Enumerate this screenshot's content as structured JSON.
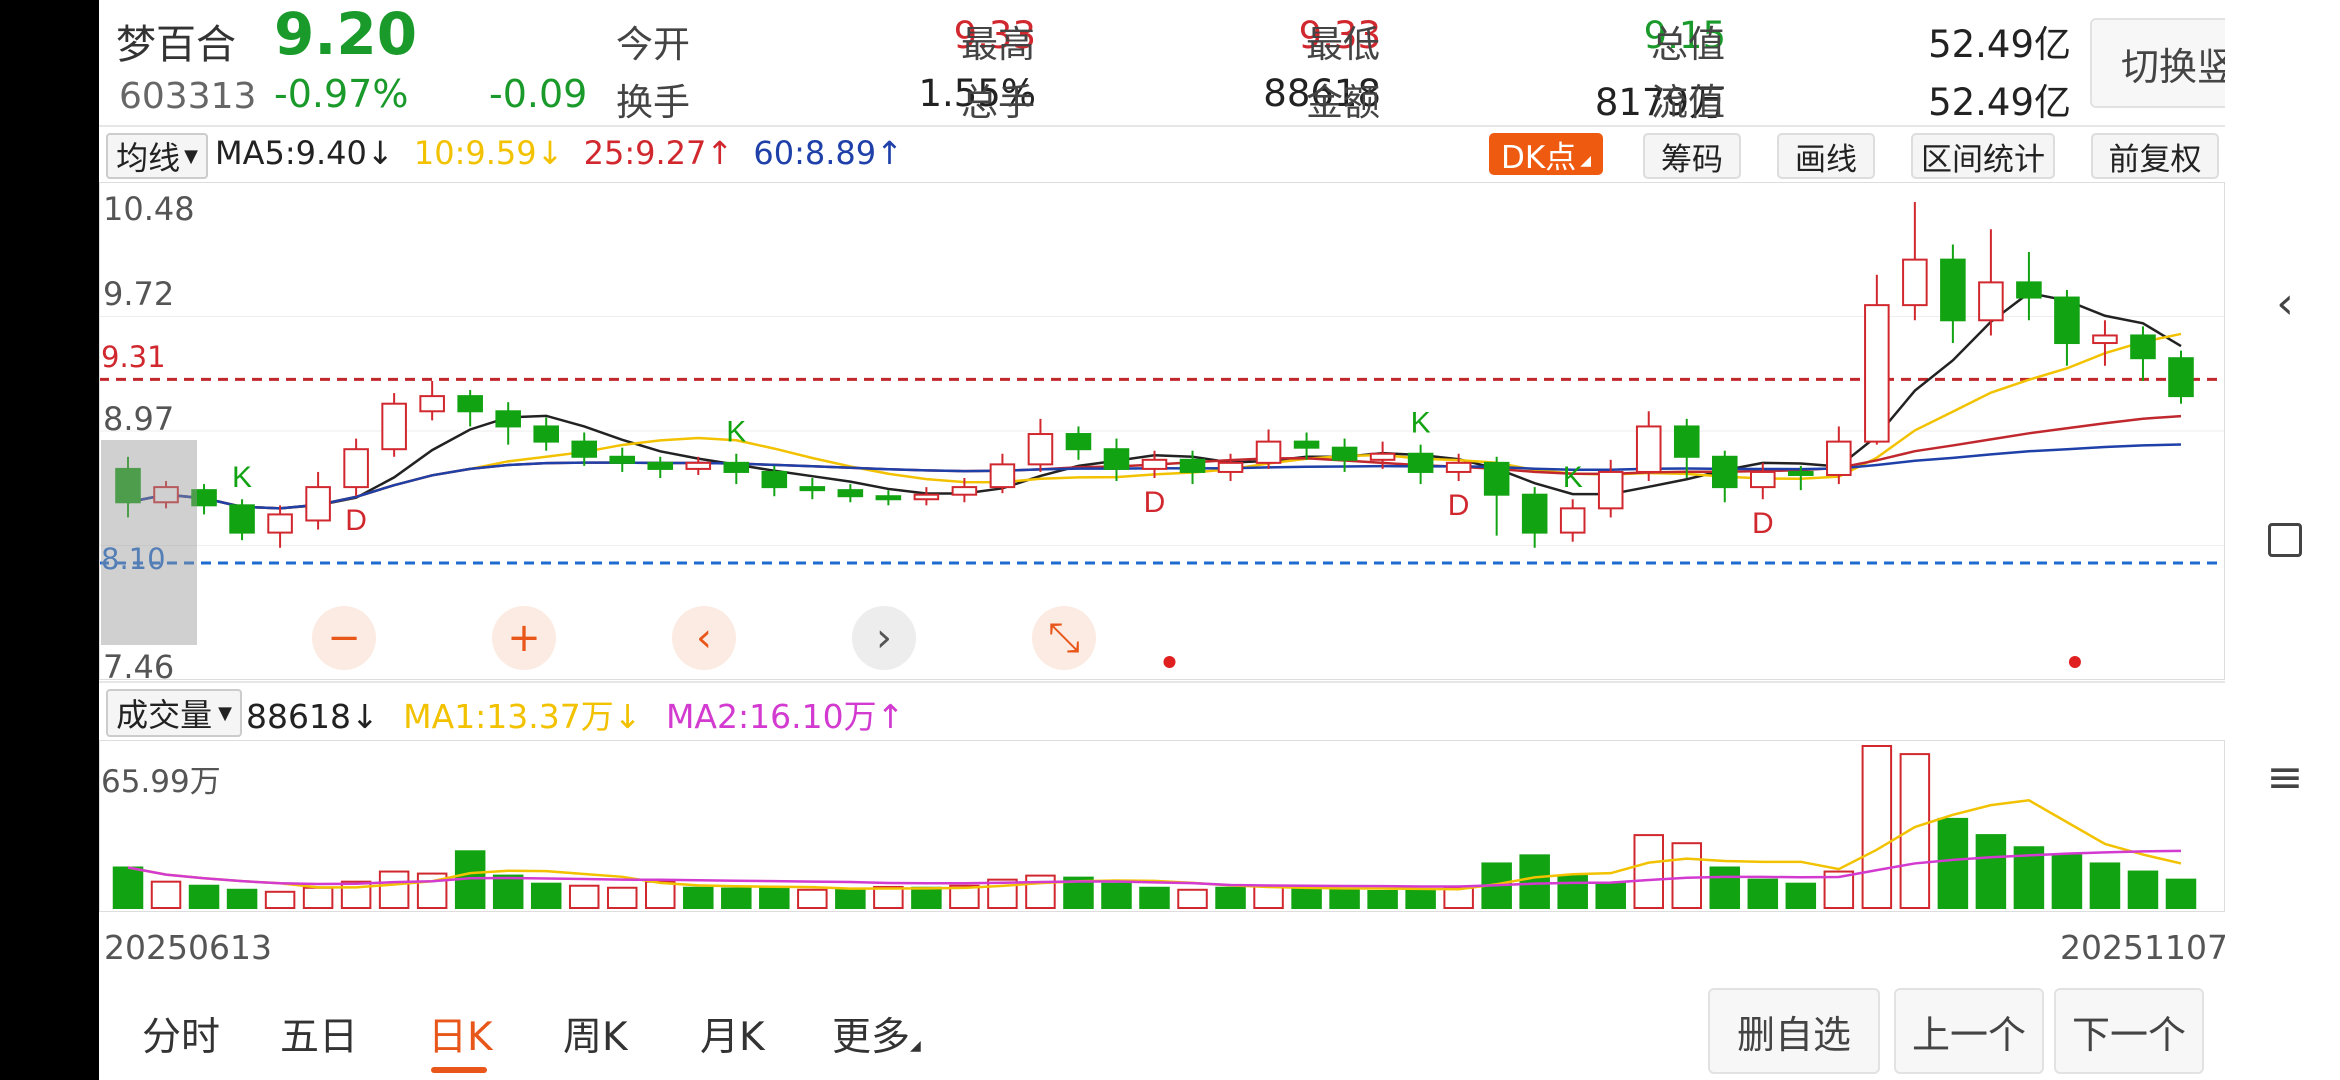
{
  "header": {
    "name": "梦百合",
    "price": "9.20",
    "code": "603313",
    "change_pct": "-0.97%",
    "change": "-0.09",
    "stats": [
      {
        "label": "今开",
        "value": "9.33",
        "color": "red"
      },
      {
        "label": "最高",
        "value": "9.33",
        "color": "red"
      },
      {
        "label": "最低",
        "value": "9.15",
        "color": "green"
      },
      {
        "label": "总值",
        "value": "52.49亿",
        "color": "dark"
      },
      {
        "label": "换手",
        "value": "1.55%",
        "color": "dark"
      },
      {
        "label": "总手",
        "value": "88618",
        "color": "dark"
      },
      {
        "label": "金额",
        "value": "8179万",
        "color": "dark"
      },
      {
        "label": "流值",
        "value": "52.49亿",
        "color": "dark"
      }
    ],
    "switch_label": "切换竖屏"
  },
  "toolbar": {
    "ma_select": "均线",
    "ma_values": [
      {
        "text": "MA5:9.40",
        "arrow": "↓",
        "color": "#222222"
      },
      {
        "text": "10:9.59",
        "arrow": "↓",
        "color": "#f2c200"
      },
      {
        "text": "25:9.27",
        "arrow": "↑",
        "color": "#d0282e"
      },
      {
        "text": "60:8.89",
        "arrow": "↑",
        "color": "#1e40a8"
      }
    ],
    "dk_label": "DK点",
    "chip_label": "筹码",
    "draw_label": "画线",
    "range_label": "区间统计",
    "adjust_label": "前复权"
  },
  "price_axis": {
    "ticks": [
      "10.48",
      "9.72",
      "9.31",
      "8.97",
      "8.10",
      "7.46"
    ]
  },
  "volume_bar": {
    "select": "成交量",
    "vol_value": "88618",
    "vol_arrow": "↓",
    "ma1": "MA1:13.37万",
    "ma1_arrow": "↓",
    "ma2": "MA2:16.10万",
    "ma2_arrow": "↑",
    "max_label": "65.99万"
  },
  "dates": {
    "start": "20250613",
    "end": "20251107"
  },
  "tabs": [
    {
      "label": "分时",
      "active": false
    },
    {
      "label": "五日",
      "active": false
    },
    {
      "label": "日K",
      "active": true
    },
    {
      "label": "周K",
      "active": false
    },
    {
      "label": "月K",
      "active": false
    },
    {
      "label": "更多",
      "active": false
    }
  ],
  "bottom_buttons": {
    "delete": "删自选",
    "prev": "上一个",
    "next": "下一个"
  },
  "controls": {
    "zoom_out": "−",
    "zoom_in": "+",
    "left": "‹",
    "right": "›",
    "shrink": "⤡"
  },
  "colors": {
    "up": "#d0282e",
    "down": "#12a312",
    "ma5": "#222222",
    "ma10": "#f2c200",
    "ma25": "#c0282e",
    "ma60": "#1e40a8",
    "accent": "#e8561a"
  },
  "chart_data": {
    "type": "candlestick",
    "price_range": [
      7.46,
      10.48
    ],
    "ref_lines": [
      9.31,
      8.1
    ],
    "signals": [
      {
        "label": "K",
        "type": "K",
        "index": 3
      },
      {
        "label": "D",
        "type": "D",
        "index": 6
      },
      {
        "label": "K",
        "type": "K",
        "index": 16
      },
      {
        "label": "D",
        "type": "D",
        "index": 27
      },
      {
        "label": "K",
        "type": "K",
        "index": 34
      },
      {
        "label": "D",
        "type": "D",
        "index": 35
      },
      {
        "label": "K",
        "type": "K",
        "index": 38
      },
      {
        "label": "D",
        "type": "D",
        "index": 43
      }
    ],
    "candles": [
      [
        8.72,
        8.5,
        8.8,
        8.4
      ],
      [
        8.5,
        8.6,
        8.64,
        8.46
      ],
      [
        8.58,
        8.48,
        8.62,
        8.42
      ],
      [
        8.48,
        8.3,
        8.52,
        8.25
      ],
      [
        8.3,
        8.42,
        8.48,
        8.2
      ],
      [
        8.38,
        8.6,
        8.7,
        8.32
      ],
      [
        8.6,
        8.85,
        8.92,
        8.54
      ],
      [
        8.85,
        9.15,
        9.22,
        8.8
      ],
      [
        9.1,
        9.2,
        9.3,
        9.04
      ],
      [
        9.2,
        9.1,
        9.24,
        9.0
      ],
      [
        9.1,
        9.0,
        9.16,
        8.88
      ],
      [
        9.0,
        8.9,
        9.06,
        8.84
      ],
      [
        8.9,
        8.8,
        8.96,
        8.74
      ],
      [
        8.8,
        8.76,
        8.86,
        8.7
      ],
      [
        8.76,
        8.72,
        8.8,
        8.66
      ],
      [
        8.72,
        8.76,
        8.8,
        8.68
      ],
      [
        8.76,
        8.7,
        8.82,
        8.62
      ],
      [
        8.7,
        8.6,
        8.74,
        8.54
      ],
      [
        8.6,
        8.58,
        8.66,
        8.52
      ],
      [
        8.58,
        8.54,
        8.62,
        8.5
      ],
      [
        8.54,
        8.52,
        8.58,
        8.48
      ],
      [
        8.52,
        8.55,
        8.6,
        8.48
      ],
      [
        8.55,
        8.6,
        8.66,
        8.5
      ],
      [
        8.6,
        8.75,
        8.82,
        8.56
      ],
      [
        8.75,
        8.95,
        9.05,
        8.7
      ],
      [
        8.95,
        8.85,
        9.0,
        8.78
      ],
      [
        8.85,
        8.72,
        8.92,
        8.64
      ],
      [
        8.72,
        8.78,
        8.84,
        8.66
      ],
      [
        8.78,
        8.7,
        8.84,
        8.62
      ],
      [
        8.7,
        8.76,
        8.82,
        8.64
      ],
      [
        8.76,
        8.9,
        8.98,
        8.72
      ],
      [
        8.9,
        8.86,
        8.96,
        8.78
      ],
      [
        8.86,
        8.78,
        8.92,
        8.7
      ],
      [
        8.78,
        8.82,
        8.9,
        8.72
      ],
      [
        8.82,
        8.7,
        8.88,
        8.62
      ],
      [
        8.7,
        8.76,
        8.82,
        8.64
      ],
      [
        8.76,
        8.55,
        8.8,
        8.28
      ],
      [
        8.55,
        8.3,
        8.6,
        8.2
      ],
      [
        8.3,
        8.46,
        8.52,
        8.24
      ],
      [
        8.46,
        8.7,
        8.78,
        8.4
      ],
      [
        8.7,
        9.0,
        9.1,
        8.64
      ],
      [
        9.0,
        8.8,
        9.05,
        8.66
      ],
      [
        8.8,
        8.6,
        8.84,
        8.5
      ],
      [
        8.6,
        8.7,
        8.76,
        8.52
      ],
      [
        8.7,
        8.68,
        8.74,
        8.58
      ],
      [
        8.68,
        8.9,
        9.0,
        8.62
      ],
      [
        8.9,
        9.8,
        10.0,
        8.88
      ],
      [
        9.8,
        10.1,
        10.48,
        9.7
      ],
      [
        10.1,
        9.7,
        10.2,
        9.55
      ],
      [
        9.7,
        9.95,
        10.3,
        9.6
      ],
      [
        9.95,
        9.85,
        10.15,
        9.7
      ],
      [
        9.85,
        9.55,
        9.9,
        9.4
      ],
      [
        9.55,
        9.6,
        9.7,
        9.4
      ],
      [
        9.6,
        9.45,
        9.66,
        9.3
      ],
      [
        9.45,
        9.2,
        9.5,
        9.15
      ]
    ],
    "volumes": [
      [
        10.0,
        1
      ],
      [
        6.5,
        0
      ],
      [
        5.5,
        1
      ],
      [
        4.5,
        1
      ],
      [
        4.0,
        0
      ],
      [
        5.0,
        0
      ],
      [
        6.5,
        0
      ],
      [
        9.0,
        0
      ],
      [
        8.5,
        0
      ],
      [
        14.0,
        1
      ],
      [
        8.0,
        1
      ],
      [
        6.0,
        1
      ],
      [
        5.5,
        0
      ],
      [
        5.0,
        0
      ],
      [
        6.5,
        0
      ],
      [
        5.0,
        1
      ],
      [
        4.8,
        1
      ],
      [
        5.0,
        1
      ],
      [
        4.5,
        0
      ],
      [
        4.6,
        1
      ],
      [
        5.2,
        0
      ],
      [
        5.0,
        1
      ],
      [
        5.5,
        0
      ],
      [
        7.0,
        0
      ],
      [
        8.0,
        0
      ],
      [
        7.5,
        1
      ],
      [
        6.0,
        1
      ],
      [
        5.0,
        1
      ],
      [
        4.5,
        0
      ],
      [
        5.0,
        1
      ],
      [
        5.5,
        0
      ],
      [
        4.8,
        1
      ],
      [
        4.5,
        1
      ],
      [
        4.2,
        1
      ],
      [
        4.6,
        1
      ],
      [
        5.0,
        0
      ],
      [
        11.0,
        1
      ],
      [
        13.0,
        1
      ],
      [
        8.0,
        1
      ],
      [
        6.0,
        1
      ],
      [
        18.0,
        0
      ],
      [
        16.0,
        0
      ],
      [
        10.0,
        1
      ],
      [
        7.0,
        1
      ],
      [
        6.0,
        1
      ],
      [
        9.0,
        0
      ],
      [
        40.0,
        0
      ],
      [
        38.0,
        0
      ],
      [
        22.0,
        1
      ],
      [
        18.0,
        1
      ],
      [
        15.0,
        1
      ],
      [
        13.0,
        1
      ],
      [
        11.0,
        1
      ],
      [
        9.0,
        1
      ],
      [
        7.0,
        1
      ]
    ]
  }
}
